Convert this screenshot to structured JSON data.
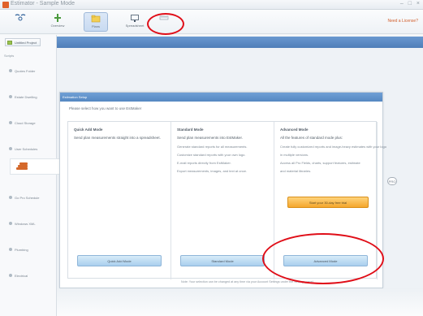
{
  "window": {
    "title": "Estimator - Sample Mode",
    "controls": "– □ ×"
  },
  "ribbon": {
    "tools": [
      {
        "label": "",
        "icon": "tool-icon"
      },
      {
        "label": "Overview",
        "icon": "pipe-icon"
      },
      {
        "label": "Plans",
        "icon": "folder-icon"
      },
      {
        "label": "Spreadsheet",
        "icon": "monitor-icon"
      },
      {
        "label": "",
        "icon": "ruler-icon"
      }
    ],
    "help_link": "Need a License?"
  },
  "sidebar": {
    "project_button": "Untitled Project",
    "header": "Scripts",
    "items": [
      "Quotes Folder",
      "Estate Dwelling",
      "Cloud Storage",
      "User Schedules",
      "Go Pro Schedule",
      "Windows XML",
      "Plumbing",
      "Electrical"
    ]
  },
  "dialog": {
    "title": "Estimation Setup",
    "prompt": "Please select how you want to use EstMaker",
    "panels": [
      {
        "title": "Quick Add Mode",
        "subtitle": "Send plan measurements straight into a spreadsheet.",
        "bullets": [],
        "button": "Quick Add Mode"
      },
      {
        "title": "Standard Mode",
        "subtitle": "Send plan measurements into EstMaker.",
        "bullets": [
          "Generate standard reports for all measurements.",
          "Customize standard reports with your own logo.",
          "E-mail reports directly from EstMaker.",
          "Export measurements, images, and text at once."
        ],
        "button": "Standard Mode"
      },
      {
        "title": "Advanced Mode",
        "subtitle": "All the features of standard mode plus:",
        "bullets": [
          "Create fully customized reports and image-heavy estimates with your logo",
          "in multiple versions.",
          "Access all Pro Fields, charts, support features, estimate",
          "and material libraries."
        ],
        "trial_button": "Start your 30-day free trial",
        "button": "Advanced Mode"
      }
    ],
    "note": "Note: Your selection can be changed at any time via your Account Settings under the Settings panel."
  },
  "icons": {
    "floating": "stack-icon",
    "right_badge": "pro-badge-icon"
  },
  "colors": {
    "accent": "#4f7eb8",
    "highlight": "#e00e18",
    "trial": "#f4a62c"
  }
}
